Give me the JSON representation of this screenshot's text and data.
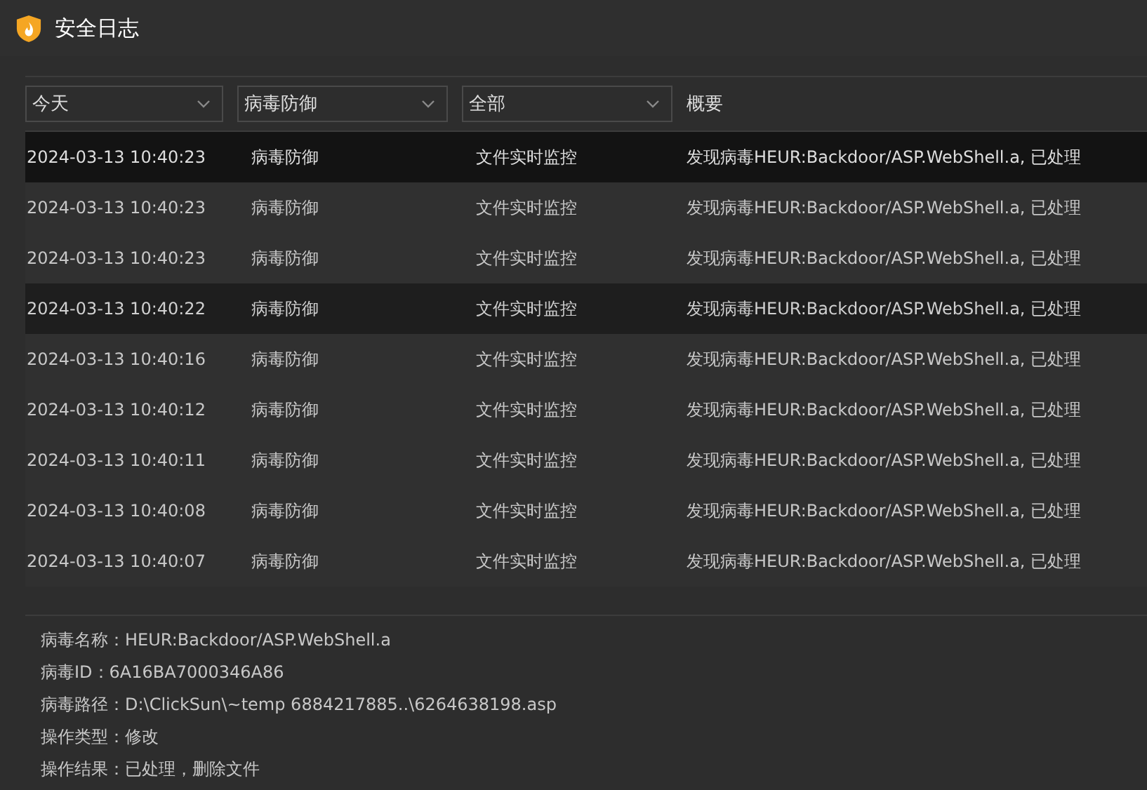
{
  "window": {
    "title": "安全日志"
  },
  "filters": [
    {
      "value": "今天"
    },
    {
      "value": "病毒防御"
    },
    {
      "value": "全部"
    }
  ],
  "table": {
    "columns": [
      "概要"
    ],
    "rows": [
      {
        "time": "2024-03-13 10:40:23",
        "module": "病毒防御",
        "source": "文件实时监控",
        "summary": "发现病毒HEUR:Backdoor/ASP.WebShell.a, 已处理",
        "selected": true,
        "hovered": false
      },
      {
        "time": "2024-03-13 10:40:23",
        "module": "病毒防御",
        "source": "文件实时监控",
        "summary": "发现病毒HEUR:Backdoor/ASP.WebShell.a, 已处理",
        "selected": false,
        "hovered": false
      },
      {
        "time": "2024-03-13 10:40:23",
        "module": "病毒防御",
        "source": "文件实时监控",
        "summary": "发现病毒HEUR:Backdoor/ASP.WebShell.a, 已处理",
        "selected": false,
        "hovered": false
      },
      {
        "time": "2024-03-13 10:40:22",
        "module": "病毒防御",
        "source": "文件实时监控",
        "summary": "发现病毒HEUR:Backdoor/ASP.WebShell.a, 已处理",
        "selected": false,
        "hovered": true
      },
      {
        "time": "2024-03-13 10:40:16",
        "module": "病毒防御",
        "source": "文件实时监控",
        "summary": "发现病毒HEUR:Backdoor/ASP.WebShell.a, 已处理",
        "selected": false,
        "hovered": false
      },
      {
        "time": "2024-03-13 10:40:12",
        "module": "病毒防御",
        "source": "文件实时监控",
        "summary": "发现病毒HEUR:Backdoor/ASP.WebShell.a, 已处理",
        "selected": false,
        "hovered": false
      },
      {
        "time": "2024-03-13 10:40:11",
        "module": "病毒防御",
        "source": "文件实时监控",
        "summary": "发现病毒HEUR:Backdoor/ASP.WebShell.a, 已处理",
        "selected": false,
        "hovered": false
      },
      {
        "time": "2024-03-13 10:40:08",
        "module": "病毒防御",
        "source": "文件实时监控",
        "summary": "发现病毒HEUR:Backdoor/ASP.WebShell.a, 已处理",
        "selected": false,
        "hovered": false
      },
      {
        "time": "2024-03-13 10:40:07",
        "module": "病毒防御",
        "source": "文件实时监控",
        "summary": "发现病毒HEUR:Backdoor/ASP.WebShell.a, 已处理",
        "selected": false,
        "hovered": false
      }
    ]
  },
  "details": [
    "病毒名称：HEUR:Backdoor/ASP.WebShell.a",
    "病毒ID：6A16BA7000346A86",
    "病毒路径：D:\\ClickSun\\~temp 6884217885..\\6264638198.asp",
    "操作类型：修改",
    "操作结果：已处理，删除文件"
  ]
}
